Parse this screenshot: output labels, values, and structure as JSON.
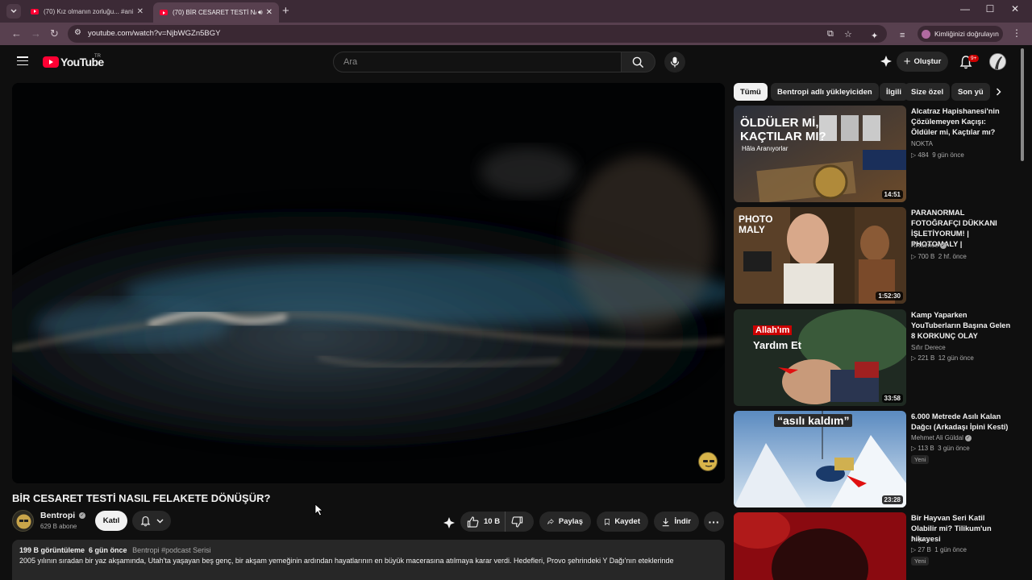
{
  "browser": {
    "tabs": [
      {
        "title": "(70) Kız olmanın zorluğu... #ani",
        "active": false
      },
      {
        "title": "(70) BİR CESARET TESTİ NA",
        "active": true
      }
    ],
    "url": "youtube.com/watch?v=NjbWGZn5BGY",
    "profile_chip": "Kimliğinizi doğrulayın"
  },
  "header": {
    "logo_text": "YouTube",
    "country_code": "TR",
    "search_placeholder": "Ara",
    "create_label": "Oluştur",
    "notification_count": "9+"
  },
  "video": {
    "title": "BİR CESARET TESTİ NASIL FELAKETE DÖNÜŞÜR?",
    "channel": {
      "name": "Bentropi",
      "subscribers": "629 B abone"
    },
    "join_label": "Katıl",
    "likes": "10 B",
    "share_label": "Paylaş",
    "save_label": "Kaydet",
    "download_label": "İndir",
    "description": {
      "views": "199 B görüntüleme",
      "date": "6 gün önce",
      "tags": "Bentropi  #podcast Serisi",
      "text": "2005 yılının sıradan bir yaz akşamında, Utah'ta yaşayan beş genç, bir akşam yemeğinin ardından hayatlarının en büyük macerasına atılmaya karar verdi. Hedefleri, Provo şehrindeki Y Dağı'nın eteklerinde"
    }
  },
  "chips": [
    "Tümü",
    "Bentropi adlı yükleyiciden",
    "İlgili",
    "Size özel",
    "Son yü"
  ],
  "recommendations": [
    {
      "title": "Alcatraz Hapishanesi'nin Çözülemeyen Kaçışı: Öldüler mi, Kaçtılar mı?",
      "channel": "NOKTA",
      "verified": false,
      "views": "484",
      "age": "9 gün önce",
      "duration": "14:51",
      "badge": "",
      "thumb_text_1": "ÖLDÜLER Mİ,",
      "thumb_text_2": "KAÇTILAR MI?",
      "thumb_text_3": "Hâla Aranıyorlar"
    },
    {
      "title": "PARANORMAL FOTOĞRAFÇI DÜKKANI İŞLETİYORUM! | PHOTOMALY |",
      "channel": "RRaenee",
      "verified": true,
      "views": "700 B",
      "age": "2 hf. önce",
      "duration": "1:52:30",
      "badge": "",
      "thumb_text_1": "PHOTO",
      "thumb_text_2": "MALY",
      "thumb_text_3": ""
    },
    {
      "title": "Kamp Yaparken YouTuberların Başına Gelen 8 KORKUNÇ OLAY",
      "channel": "Sıfır Derece",
      "verified": false,
      "views": "221 B",
      "age": "12 gün önce",
      "duration": "33:58",
      "badge": "",
      "thumb_text_1": "Allah'ım",
      "thumb_text_2": "Yardım Et",
      "thumb_text_3": ""
    },
    {
      "title": "6.000 Metrede Asılı Kalan Dağcı (Arkadaşı İpini Kesti)",
      "channel": "Mehmet Ali Güldal",
      "verified": true,
      "views": "113 B",
      "age": "3 gün önce",
      "duration": "23:28",
      "badge": "Yeni",
      "thumb_text_1": "“asılı kaldım”",
      "thumb_text_2": "",
      "thumb_text_3": ""
    },
    {
      "title": "Bir Hayvan Seri Katil Olabilir mi?  Tilikum'un hikayesi",
      "channel": "Arçura",
      "verified": false,
      "views": "27 B",
      "age": "1 gün önce",
      "duration": "",
      "badge": "Yeni",
      "thumb_text_1": "",
      "thumb_text_2": "",
      "thumb_text_3": ""
    }
  ],
  "colors": {
    "accent": "#ff0033",
    "background": "#0f0f0f",
    "surface": "#272727",
    "tabbar": "#3c2a36"
  }
}
